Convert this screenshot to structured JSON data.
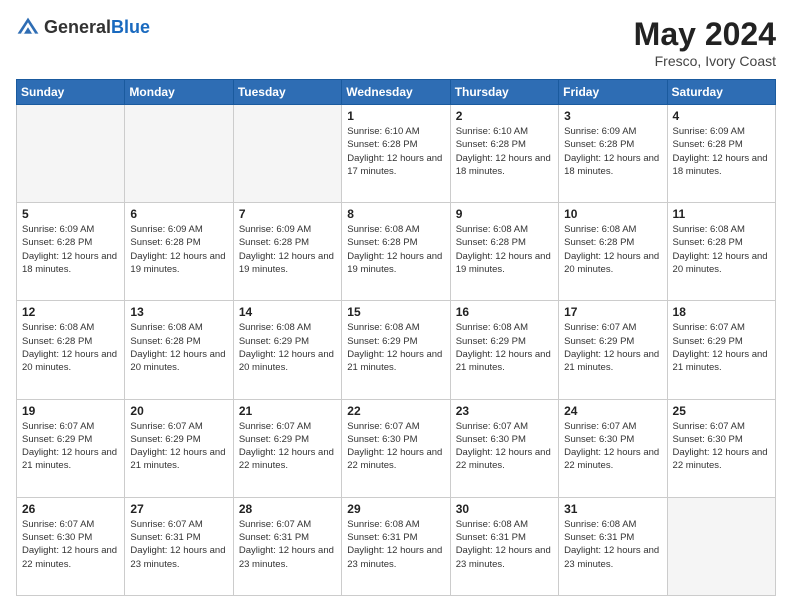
{
  "header": {
    "logo_general": "General",
    "logo_blue": "Blue",
    "title": "May 2024",
    "location": "Fresco, Ivory Coast"
  },
  "days_of_week": [
    "Sunday",
    "Monday",
    "Tuesday",
    "Wednesday",
    "Thursday",
    "Friday",
    "Saturday"
  ],
  "weeks": [
    [
      {
        "day": "",
        "info": ""
      },
      {
        "day": "",
        "info": ""
      },
      {
        "day": "",
        "info": ""
      },
      {
        "day": "1",
        "info": "Sunrise: 6:10 AM\nSunset: 6:28 PM\nDaylight: 12 hours and 17 minutes."
      },
      {
        "day": "2",
        "info": "Sunrise: 6:10 AM\nSunset: 6:28 PM\nDaylight: 12 hours and 18 minutes."
      },
      {
        "day": "3",
        "info": "Sunrise: 6:09 AM\nSunset: 6:28 PM\nDaylight: 12 hours and 18 minutes."
      },
      {
        "day": "4",
        "info": "Sunrise: 6:09 AM\nSunset: 6:28 PM\nDaylight: 12 hours and 18 minutes."
      }
    ],
    [
      {
        "day": "5",
        "info": "Sunrise: 6:09 AM\nSunset: 6:28 PM\nDaylight: 12 hours and 18 minutes."
      },
      {
        "day": "6",
        "info": "Sunrise: 6:09 AM\nSunset: 6:28 PM\nDaylight: 12 hours and 19 minutes."
      },
      {
        "day": "7",
        "info": "Sunrise: 6:09 AM\nSunset: 6:28 PM\nDaylight: 12 hours and 19 minutes."
      },
      {
        "day": "8",
        "info": "Sunrise: 6:08 AM\nSunset: 6:28 PM\nDaylight: 12 hours and 19 minutes."
      },
      {
        "day": "9",
        "info": "Sunrise: 6:08 AM\nSunset: 6:28 PM\nDaylight: 12 hours and 19 minutes."
      },
      {
        "day": "10",
        "info": "Sunrise: 6:08 AM\nSunset: 6:28 PM\nDaylight: 12 hours and 20 minutes."
      },
      {
        "day": "11",
        "info": "Sunrise: 6:08 AM\nSunset: 6:28 PM\nDaylight: 12 hours and 20 minutes."
      }
    ],
    [
      {
        "day": "12",
        "info": "Sunrise: 6:08 AM\nSunset: 6:28 PM\nDaylight: 12 hours and 20 minutes."
      },
      {
        "day": "13",
        "info": "Sunrise: 6:08 AM\nSunset: 6:28 PM\nDaylight: 12 hours and 20 minutes."
      },
      {
        "day": "14",
        "info": "Sunrise: 6:08 AM\nSunset: 6:29 PM\nDaylight: 12 hours and 20 minutes."
      },
      {
        "day": "15",
        "info": "Sunrise: 6:08 AM\nSunset: 6:29 PM\nDaylight: 12 hours and 21 minutes."
      },
      {
        "day": "16",
        "info": "Sunrise: 6:08 AM\nSunset: 6:29 PM\nDaylight: 12 hours and 21 minutes."
      },
      {
        "day": "17",
        "info": "Sunrise: 6:07 AM\nSunset: 6:29 PM\nDaylight: 12 hours and 21 minutes."
      },
      {
        "day": "18",
        "info": "Sunrise: 6:07 AM\nSunset: 6:29 PM\nDaylight: 12 hours and 21 minutes."
      }
    ],
    [
      {
        "day": "19",
        "info": "Sunrise: 6:07 AM\nSunset: 6:29 PM\nDaylight: 12 hours and 21 minutes."
      },
      {
        "day": "20",
        "info": "Sunrise: 6:07 AM\nSunset: 6:29 PM\nDaylight: 12 hours and 21 minutes."
      },
      {
        "day": "21",
        "info": "Sunrise: 6:07 AM\nSunset: 6:29 PM\nDaylight: 12 hours and 22 minutes."
      },
      {
        "day": "22",
        "info": "Sunrise: 6:07 AM\nSunset: 6:30 PM\nDaylight: 12 hours and 22 minutes."
      },
      {
        "day": "23",
        "info": "Sunrise: 6:07 AM\nSunset: 6:30 PM\nDaylight: 12 hours and 22 minutes."
      },
      {
        "day": "24",
        "info": "Sunrise: 6:07 AM\nSunset: 6:30 PM\nDaylight: 12 hours and 22 minutes."
      },
      {
        "day": "25",
        "info": "Sunrise: 6:07 AM\nSunset: 6:30 PM\nDaylight: 12 hours and 22 minutes."
      }
    ],
    [
      {
        "day": "26",
        "info": "Sunrise: 6:07 AM\nSunset: 6:30 PM\nDaylight: 12 hours and 22 minutes."
      },
      {
        "day": "27",
        "info": "Sunrise: 6:07 AM\nSunset: 6:31 PM\nDaylight: 12 hours and 23 minutes."
      },
      {
        "day": "28",
        "info": "Sunrise: 6:07 AM\nSunset: 6:31 PM\nDaylight: 12 hours and 23 minutes."
      },
      {
        "day": "29",
        "info": "Sunrise: 6:08 AM\nSunset: 6:31 PM\nDaylight: 12 hours and 23 minutes."
      },
      {
        "day": "30",
        "info": "Sunrise: 6:08 AM\nSunset: 6:31 PM\nDaylight: 12 hours and 23 minutes."
      },
      {
        "day": "31",
        "info": "Sunrise: 6:08 AM\nSunset: 6:31 PM\nDaylight: 12 hours and 23 minutes."
      },
      {
        "day": "",
        "info": ""
      }
    ]
  ],
  "colors": {
    "header_bg": "#2e6db4",
    "accent": "#1a6abf"
  }
}
